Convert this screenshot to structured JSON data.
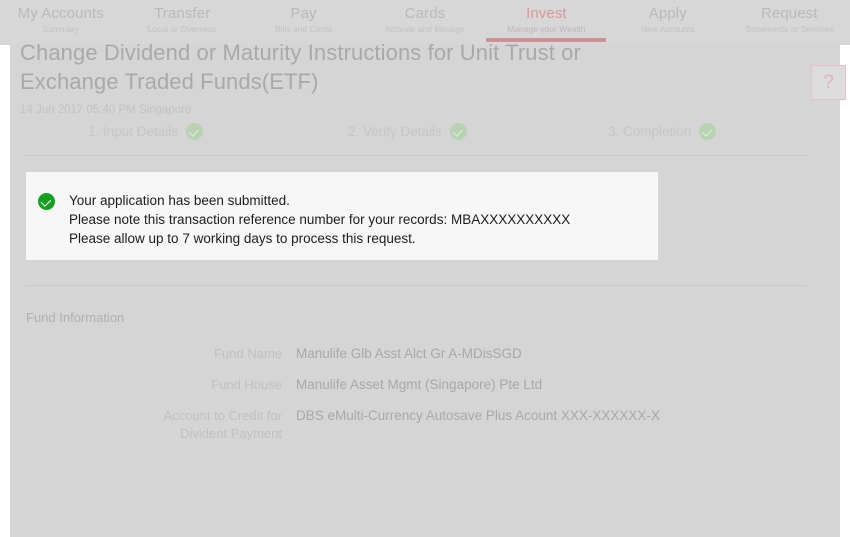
{
  "nav": {
    "tabs": [
      {
        "title": "My Accounts",
        "subtitle": "Summary",
        "active": false
      },
      {
        "title": "Transfer",
        "subtitle": "Local or Overseas",
        "active": false
      },
      {
        "title": "Pay",
        "subtitle": "Bills and Cards",
        "active": false
      },
      {
        "title": "Cards",
        "subtitle": "Activate and Manage",
        "active": false
      },
      {
        "title": "Invest",
        "subtitle": "Manage your Wealth",
        "active": true
      },
      {
        "title": "Apply",
        "subtitle": "New Accounts",
        "active": false
      },
      {
        "title": "Request",
        "subtitle": "Statements or Services",
        "active": false
      }
    ],
    "active_accent": "#d08f93"
  },
  "help": {
    "label": "?",
    "icon": "question-mark-icon"
  },
  "header": {
    "title": "Change Dividend or Maturity Instructions for Unit Trust or Exchange Traded Funds(ETF)",
    "timestamp": "14 Jun 2017 05:40 PM Singapore"
  },
  "steps": [
    {
      "label": "1. Input Details",
      "completed": true,
      "icon": "check-circle-icon"
    },
    {
      "label": "2. Verify Details",
      "completed": true,
      "icon": "check-circle-icon"
    },
    {
      "label": "3. Completion",
      "completed": true,
      "icon": "check-circle-icon"
    }
  ],
  "message": {
    "icon": "check-circle-icon",
    "icon_color": "#16a01f",
    "lines": [
      "Your application has been submitted.",
      "Please note this transaction reference number for your records: MBAXXXXXXXXXX",
      "Please allow up to 7 working days to process this request."
    ]
  },
  "fund_information": {
    "section_title": "Fund Information",
    "rows": [
      {
        "label": "Fund Name",
        "value": "Manulife Glb Asst Alct Gr A-MDisSGD"
      },
      {
        "label": "Fund House",
        "value": "Manulife Asset Mgmt (Singapore) Pte Ltd"
      },
      {
        "label": "Account to Credit for\nDivident Payment",
        "value": "DBS eMulti-Currency Autosave Plus Acount XXX-XXXXXX-X"
      }
    ]
  }
}
